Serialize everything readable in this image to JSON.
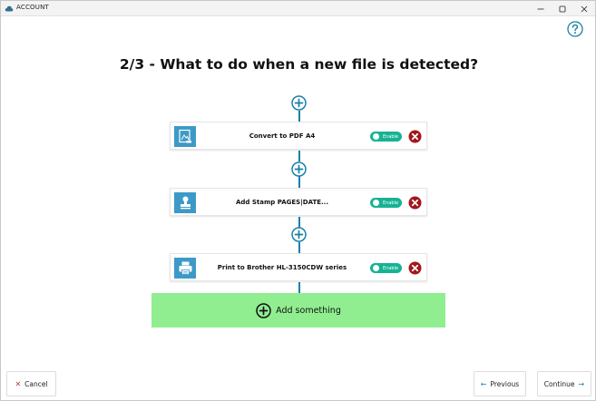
{
  "window": {
    "title": "ACCOUNT",
    "controls": [
      "minimize-icon",
      "maximize-icon",
      "close-icon"
    ]
  },
  "help_icon": "question-circle-icon",
  "heading": "2/3 - What to do when a new file is detected?",
  "steps": [
    {
      "label": "Convert to PDF A4",
      "toggle": "Enable",
      "icon": "pdf-convert-icon"
    },
    {
      "label": "Add Stamp PAGES|DATE...",
      "toggle": "Enable",
      "icon": "stamp-icon"
    },
    {
      "label": "Print to Brother HL-3150CDW series",
      "toggle": "Enable",
      "icon": "printer-icon"
    }
  ],
  "add_something": {
    "label": "Add something",
    "icon": "plus-circle-icon"
  },
  "buttons": {
    "cancel": "Cancel",
    "previous": "Previous",
    "continue": "Continue"
  },
  "colors": {
    "accent": "#1a7fa8",
    "step_icon_bg": "#3d9ac7",
    "toggle": "#16b393",
    "remove": "#a3171c",
    "add_panel": "#90ee90"
  }
}
